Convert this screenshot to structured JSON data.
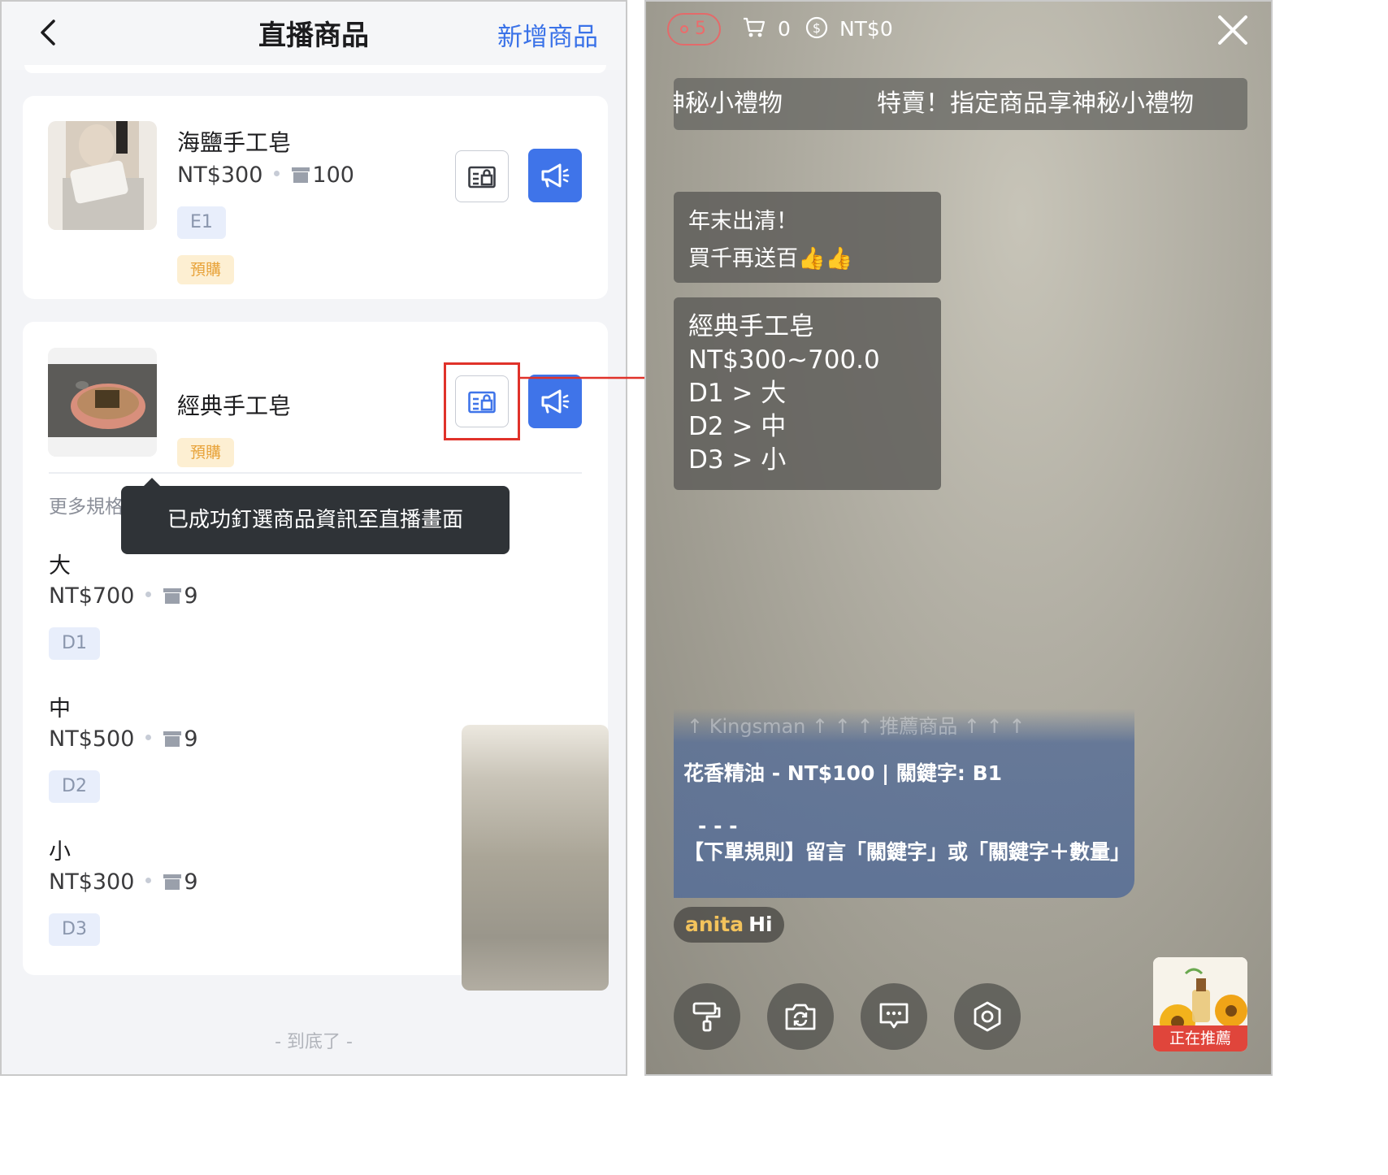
{
  "left": {
    "header": {
      "title": "直播商品",
      "add_product": "新增商品"
    },
    "products": [
      {
        "name": "海鹽手工皂",
        "price": "NT$300",
        "stock": "100",
        "code": "E1",
        "preorder": "預購"
      },
      {
        "name": "經典手工皂",
        "preorder": "預購",
        "more_specs": "更多規格"
      }
    ],
    "toast": "已成功釘選商品資訊至直播畫面",
    "variants": [
      {
        "name": "大",
        "price": "NT$700",
        "stock": "9",
        "code": "D1"
      },
      {
        "name": "中",
        "price": "NT$500",
        "stock": "9",
        "code": "D2"
      },
      {
        "name": "小",
        "price": "NT$300",
        "stock": "9",
        "code": "D3"
      }
    ],
    "bottom_text": "- 到底了 -"
  },
  "right": {
    "viewers": "5",
    "cart_count": "0",
    "revenue": "NT$0",
    "marquee": {
      "part1": "神秘小禮物",
      "part2": "特賣！指定商品享神秘小禮物"
    },
    "note1": {
      "line1": "年末出清！",
      "line2": "買千再送百👍👍"
    },
    "note2": {
      "line1": "經典手工皂",
      "line2": "NT$300~700.0",
      "line3": "D1 > 大",
      "line4": "D2 > 中",
      "line5": "D3 > 小"
    },
    "recommend": {
      "header": "↑ Kingsman ↑ ↑ ↑ 推薦商品 ↑ ↑ ↑",
      "line1": "花香精油 - NT$100 | 關鍵字: B1",
      "line2": "- - -",
      "line3": "【下單規則】留言「關鍵字」或「關鍵字＋數量」"
    },
    "chat": {
      "user": "anita",
      "message": "Hi"
    },
    "featured_label": "正在推薦",
    "colors": {
      "accent": "#3f74e9",
      "highlight": "#e0322a",
      "viewer_badge": "#ec6b6b"
    }
  }
}
